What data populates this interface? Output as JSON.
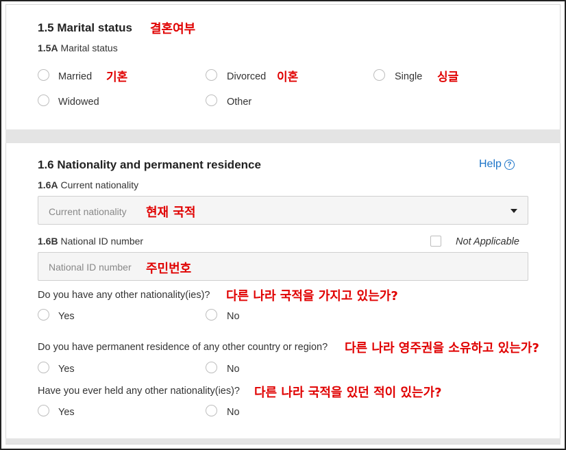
{
  "marital": {
    "title": "1.5 Marital status",
    "title_kr": "결혼여부",
    "sub_code": "1.5A",
    "sub_label": "Marital status",
    "options": [
      {
        "label": "Married",
        "kr": "기혼"
      },
      {
        "label": "Divorced",
        "kr": "이혼"
      },
      {
        "label": "Single",
        "kr": "싱글"
      },
      {
        "label": "Widowed",
        "kr": ""
      },
      {
        "label": "Other",
        "kr": ""
      }
    ]
  },
  "nationality": {
    "title": "1.6 Nationality and permanent residence",
    "help": "Help",
    "current": {
      "code": "1.6A",
      "label": "Current nationality",
      "placeholder": "Current nationality",
      "kr": "현재 국적"
    },
    "national_id": {
      "code": "1.6B",
      "label": "National ID number",
      "not_applicable": "Not Applicable",
      "placeholder": "National ID number",
      "kr": "주민번호"
    },
    "q1": {
      "text": "Do you have any other nationality(ies)?",
      "kr": "다른 나라 국적을 가지고 있는가?",
      "yes": "Yes",
      "no": "No"
    },
    "q2": {
      "text": "Do you have permanent residence of any other country or region?",
      "kr": "다른 나라 영주권을 소유하고 있는가?",
      "yes": "Yes",
      "no": "No"
    },
    "q3": {
      "text": "Have you ever held any other nationality(ies)?",
      "kr": "다른 나라 국적을 있던 적이 있는가?",
      "yes": "Yes",
      "no": "No"
    }
  },
  "colors": {
    "annotation": "#e00000",
    "help_link": "#1a73c8",
    "divider": "#e4e4e4"
  },
  "icons": {
    "help": "help-circle-icon",
    "dropdown": "caret-down-icon"
  }
}
